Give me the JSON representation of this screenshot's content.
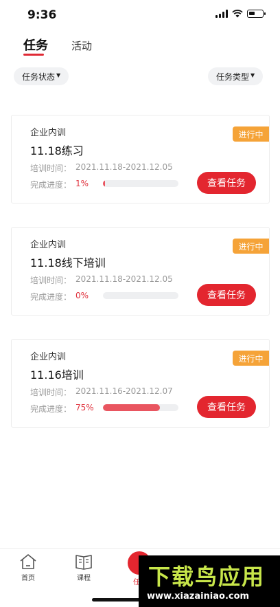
{
  "status_bar": {
    "time": "9:36"
  },
  "tabs": [
    {
      "label": "任务",
      "active": true
    },
    {
      "label": "活动",
      "active": false
    }
  ],
  "filters": {
    "task_status": "任务状态",
    "task_type": "任务类型"
  },
  "tasks": [
    {
      "category": "企业内训",
      "title": "11.18练习",
      "time_label": "培训时间：",
      "time_range": "2021.11.18-2021.12.05",
      "progress_label": "完成进度：",
      "progress_text": "1%",
      "progress": 0.01,
      "status": "进行中",
      "button": "查看任务"
    },
    {
      "category": "企业内训",
      "title": "11.18线下培训",
      "time_label": "培训时间：",
      "time_range": "2021.11.18-2021.12.05",
      "progress_label": "完成进度：",
      "progress_text": "0%",
      "progress": 0.0,
      "status": "进行中",
      "button": "查看任务"
    },
    {
      "category": "企业内训",
      "title": "11.16培训",
      "time_label": "培训时间：",
      "time_range": "2021.11.16-2021.12.07",
      "progress_label": "完成进度：",
      "progress_text": "75%",
      "progress": 0.75,
      "status": "进行中",
      "button": "查看任务"
    }
  ],
  "bottom_nav": {
    "home": "首页",
    "courses": "课程",
    "task_partial": "任"
  },
  "watermark": {
    "title": "下载鸟应用",
    "url": "www.xiazainiao.com"
  },
  "colors": {
    "accent": "#e3262f",
    "status_tag": "#f5a338",
    "progress_fill": "#e95560"
  }
}
